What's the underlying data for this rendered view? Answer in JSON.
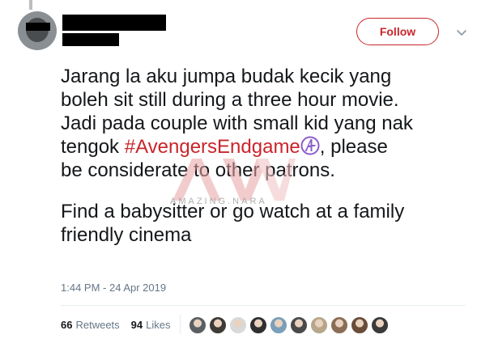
{
  "tweet": {
    "follow_label": "Follow",
    "line1": "Jarang la aku jumpa budak kecik yang",
    "line2": "boleh sit still during a three hour movie.",
    "line3": "Jadi pada couple with small kid yang nak",
    "line4_pre": "tengok ",
    "hashtag": "#AvengersEndgame",
    "line4_post": ", please",
    "line5": "be considerate to other patrons.",
    "line6": "Find a babysitter or go watch at a family",
    "line7": "friendly cinema",
    "timestamp": "1:44 PM - 24 Apr 2019",
    "retweets_count": "66",
    "retweets_label": "Retweets",
    "likes_count": "94",
    "likes_label": "Likes"
  },
  "watermark": {
    "text": "AMAZING.NARA"
  },
  "colors": {
    "accent": "#c9252b",
    "secondary_text": "#657786",
    "avengers_purple": "#8b5cc7"
  },
  "liker_avatars": [
    "#5b5f63",
    "#3e3a36",
    "#d9d9d9",
    "#2f2f2f",
    "#7a9fb8",
    "#4a4a4a",
    "#b7a68a",
    "#8a6d55",
    "#6b4c3b",
    "#3a3a3a"
  ]
}
